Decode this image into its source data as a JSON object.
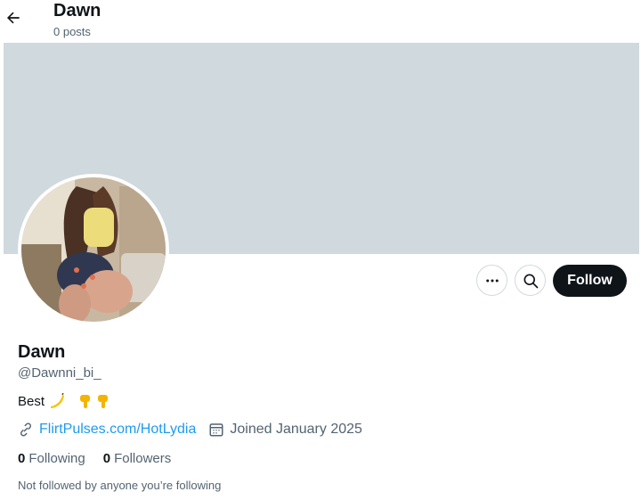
{
  "header": {
    "title": "Dawn",
    "subtitle": "0 posts"
  },
  "profile": {
    "display_name": "Dawn",
    "handle": "@Dawnni_bi_",
    "bio_text": "Best",
    "bio_emojis": [
      "banana-emoji",
      "pointing-down-emoji",
      "pointing-down-emoji"
    ],
    "link": "FlirtPulses.com/HotLydia",
    "joined": "Joined January 2025",
    "following_count": "0",
    "following_label": "Following",
    "followers_count": "0",
    "followers_label": "Followers",
    "not_followed": "Not followed by anyone you’re following"
  },
  "actions": {
    "follow_label": "Follow"
  },
  "colors": {
    "banner": "#cfd9de",
    "link": "#1d9bf0",
    "button_dark": "#0f1419",
    "muted": "#536471"
  },
  "icons": [
    "arrow-left-icon",
    "more-icon",
    "search-icon",
    "link-icon",
    "calendar-icon"
  ]
}
